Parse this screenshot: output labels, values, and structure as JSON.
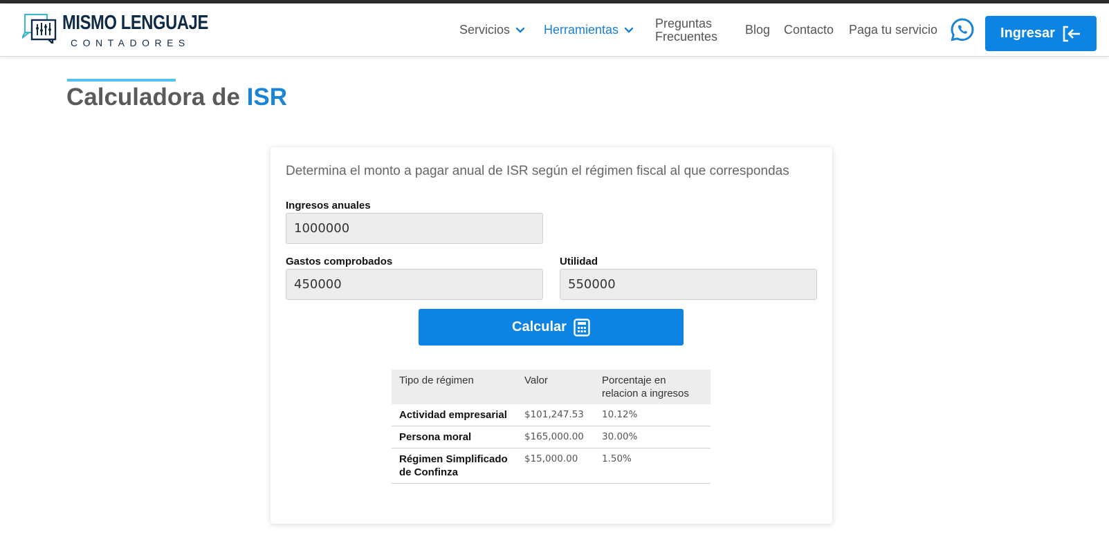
{
  "brand": {
    "title": "MISMO LENGUAJE",
    "subtitle": "CONTADORES",
    "colors": {
      "navy": "#0e2a47",
      "teal": "#3fb6c9",
      "accent": "#0d84e3"
    }
  },
  "nav": {
    "items": [
      {
        "label": "Servicios",
        "has_dropdown": true,
        "active": false
      },
      {
        "label": "Herramientas",
        "has_dropdown": true,
        "active": true
      },
      {
        "label_line1": "Preguntas",
        "label_line2": "Frecuentes"
      },
      {
        "label": "Blog"
      },
      {
        "label": "Contacto"
      },
      {
        "label": "Paga tu servicio"
      }
    ],
    "whatsapp_icon": "whatsapp-icon",
    "login_label": "Ingresar",
    "login_icon": "sign-in-icon"
  },
  "page": {
    "title_main": "Calculadora de ",
    "title_accent": "ISR"
  },
  "calculator": {
    "description": "Determina el monto a pagar anual de ISR según el régimen fiscal al que correspondas",
    "fields": {
      "ingresos": {
        "label": "Ingresos anuales",
        "value": "1000000"
      },
      "gastos": {
        "label": "Gastos comprobados",
        "value": "450000"
      },
      "utilidad": {
        "label": "Utilidad",
        "value": "550000"
      }
    },
    "button_label": "Calcular",
    "button_icon": "calculator-icon"
  },
  "results": {
    "headers": [
      "Tipo de régimen",
      "Valor",
      "Porcentaje en relacion a ingresos"
    ],
    "rows": [
      {
        "regime": "Actividad empresarial",
        "value": "$101,247.53",
        "percent": "10.12%"
      },
      {
        "regime": "Persona moral",
        "value": "$165,000.00",
        "percent": "30.00%"
      },
      {
        "regime": "Régimen Simplificado de Confinza",
        "value": "$15,000.00",
        "percent": "1.50%"
      }
    ]
  }
}
